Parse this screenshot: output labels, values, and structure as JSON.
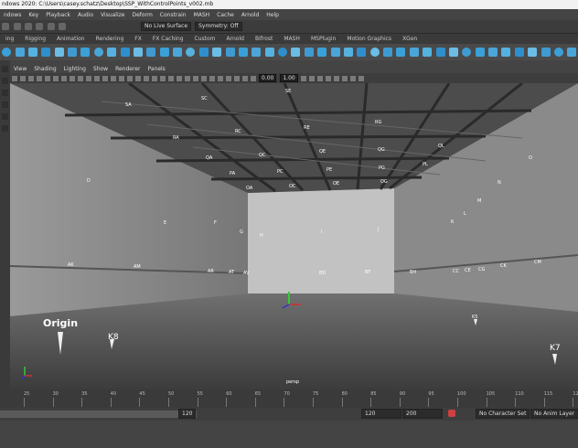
{
  "window": {
    "title": "ndows 2020: C:\\Users\\casey.schatz\\Desktop\\SSP_WithControlPoints_v002.mb"
  },
  "menus": [
    "ndows",
    "Key",
    "Playback",
    "Audio",
    "Visualize",
    "Deform",
    "Constrain",
    "MASH",
    "Cache",
    "Arnold",
    "Help"
  ],
  "status": {
    "live_surface": "No Live Surface",
    "symmetry": "Symmetry: Off"
  },
  "shelf_tabs": [
    "ing",
    "Rigging",
    "Animation",
    "Rendering",
    "FX",
    "FX Caching",
    "Custom",
    "Arnold",
    "Bifrost",
    "MASH",
    "MSPlugin",
    "Motion Graphics",
    "XGen"
  ],
  "panel_menu": [
    "View",
    "Shading",
    "Lighting",
    "Show",
    "Renderer",
    "Panels"
  ],
  "panel_fields": {
    "value1": "0.00",
    "value2": "1.00"
  },
  "viewport": {
    "camera": "persp",
    "origin_label": "Origin",
    "markers": [
      {
        "t": "SA"
      },
      {
        "t": "SC"
      },
      {
        "t": "SE"
      },
      {
        "t": "RA"
      },
      {
        "t": "RC"
      },
      {
        "t": "RE"
      },
      {
        "t": "RG"
      },
      {
        "t": "QA"
      },
      {
        "t": "QC"
      },
      {
        "t": "QE"
      },
      {
        "t": "QG"
      },
      {
        "t": "QL"
      },
      {
        "t": "PA"
      },
      {
        "t": "PC"
      },
      {
        "t": "PE"
      },
      {
        "t": "PG"
      },
      {
        "t": "PL"
      },
      {
        "t": "OA"
      },
      {
        "t": "OC"
      },
      {
        "t": "OE"
      },
      {
        "t": "OG"
      },
      {
        "t": "O"
      },
      {
        "t": "N"
      },
      {
        "t": "M"
      },
      {
        "t": "L"
      },
      {
        "t": "K"
      },
      {
        "t": "D"
      },
      {
        "t": "E"
      },
      {
        "t": "F"
      },
      {
        "t": "G"
      },
      {
        "t": "H"
      },
      {
        "t": "I"
      },
      {
        "t": "J"
      },
      {
        "t": "AK"
      },
      {
        "t": "AM"
      },
      {
        "t": "AR"
      },
      {
        "t": "AT"
      },
      {
        "t": "AV"
      },
      {
        "t": "BD"
      },
      {
        "t": "BF"
      },
      {
        "t": "BH"
      },
      {
        "t": "CC"
      },
      {
        "t": "CE"
      },
      {
        "t": "CG"
      },
      {
        "t": "CK"
      },
      {
        "t": "CM"
      },
      {
        "t": "K8"
      },
      {
        "t": "K7"
      },
      {
        "t": "K5"
      }
    ]
  },
  "timeline": {
    "ticks": [
      "25",
      "30",
      "35",
      "40",
      "45",
      "50",
      "55",
      "60",
      "65",
      "70",
      "75",
      "80",
      "85",
      "90",
      "95",
      "100",
      "105",
      "110",
      "115",
      "120"
    ]
  },
  "range": {
    "end": "120",
    "current_start": "120",
    "current_end": "200"
  },
  "bottom": {
    "character_set": "No Character Set",
    "anim_layer": "No Anim Layer"
  },
  "colors": {
    "viewport_top": "#8d8d8d",
    "floor": "#5a5a5a",
    "accent_red": "#d04040"
  }
}
